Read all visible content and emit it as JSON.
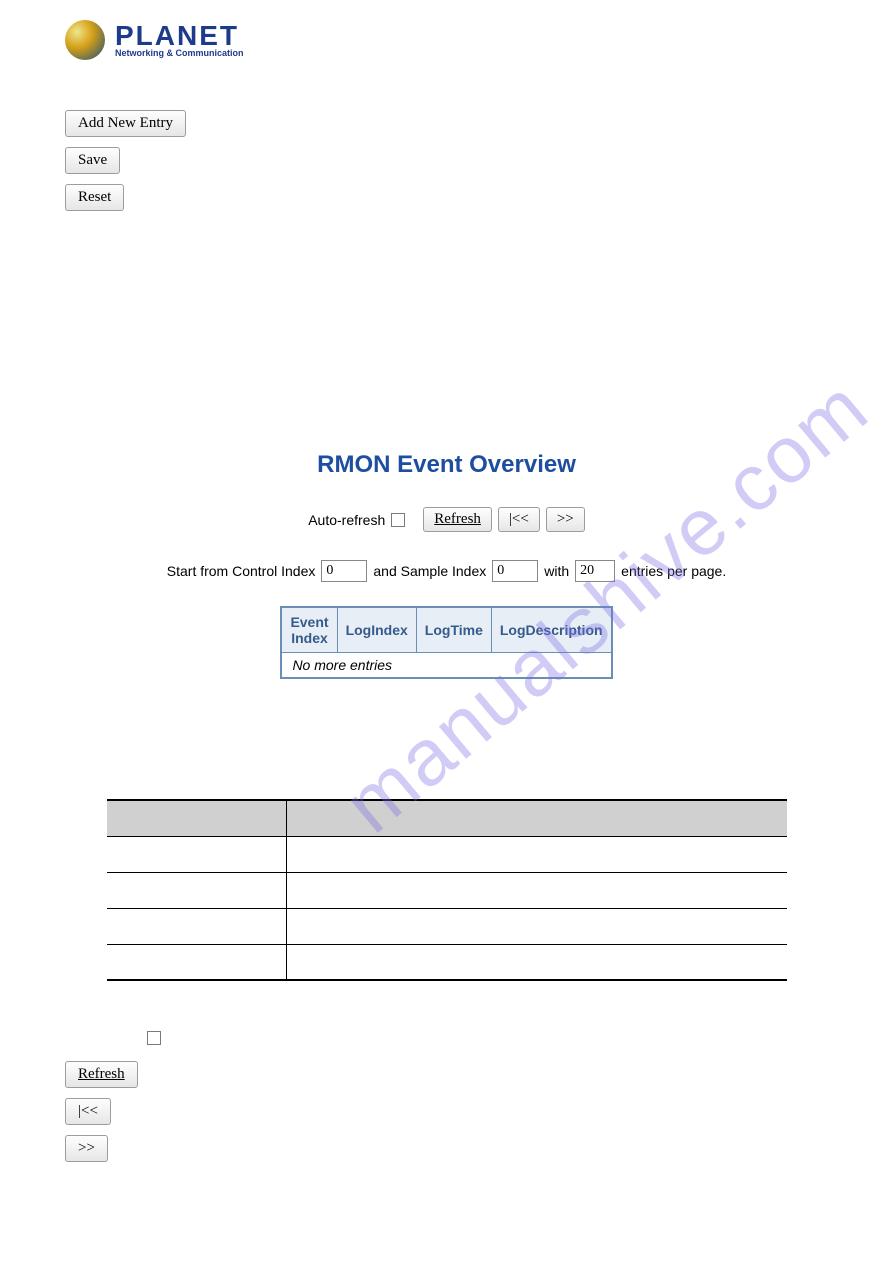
{
  "logo": {
    "main": "PLANET",
    "sub": "Networking & Communication"
  },
  "top_buttons": {
    "add": "Add New Entry",
    "save": "Save",
    "reset": "Reset"
  },
  "overview": {
    "title": "RMON Event Overview",
    "auto_refresh_label": "Auto-refresh",
    "refresh_btn": "Refresh",
    "first_btn": "|<<",
    "next_btn": ">>",
    "row2_start": "Start from Control Index",
    "row2_sample": "and Sample Index",
    "row2_with": "with",
    "row2_entries": "entries per page.",
    "control_index": "0",
    "sample_index": "0",
    "entries_per_page": "20",
    "headers": {
      "event_index": "Event\nIndex",
      "log_index": "LogIndex",
      "log_time": "LogTime",
      "log_desc": "LogDescription"
    },
    "empty_msg": "No more entries"
  },
  "bottom": {
    "refresh": "Refresh",
    "first": "|<<",
    "next": ">>"
  },
  "watermark": "manualshive.com"
}
